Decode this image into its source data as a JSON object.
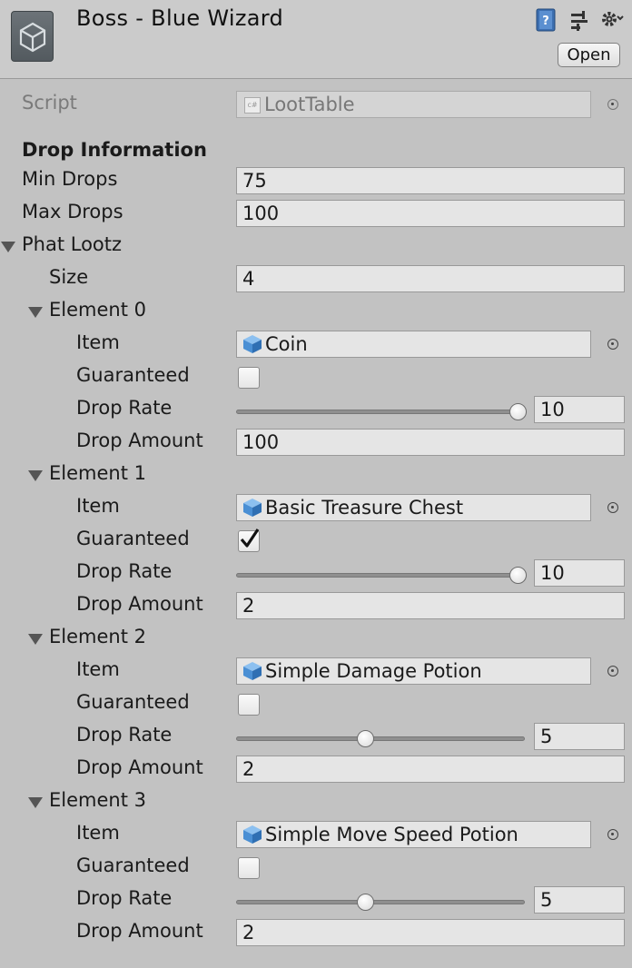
{
  "header": {
    "title": "Boss - Blue Wizard",
    "open_label": "Open",
    "icons": [
      "unity-object-icon",
      "help-book-icon",
      "preset-icon",
      "gear-icon"
    ]
  },
  "script": {
    "label": "Script",
    "value": "LootTable",
    "icon": "csharp-script-icon"
  },
  "drop_info": {
    "heading": "Drop Information",
    "min_label": "Min Drops",
    "min_value": "75",
    "max_label": "Max Drops",
    "max_value": "100"
  },
  "phat_lootz": {
    "label": "Phat Lootz",
    "size_label": "Size",
    "size_value": "4",
    "field_labels": {
      "item": "Item",
      "guaranteed": "Guaranteed",
      "rate": "Drop Rate",
      "amount": "Drop Amount"
    },
    "elements": [
      {
        "label": "Element 0",
        "item": "Coin",
        "guaranteed": false,
        "rate": "10",
        "rate_fraction": 1.0,
        "amount": "100"
      },
      {
        "label": "Element 1",
        "item": "Basic Treasure Chest",
        "guaranteed": true,
        "rate": "10",
        "rate_fraction": 1.0,
        "amount": "2"
      },
      {
        "label": "Element 2",
        "item": "Simple Damage Potion",
        "guaranteed": false,
        "rate": "5",
        "rate_fraction": 0.5,
        "amount": "2"
      },
      {
        "label": "Element 3",
        "item": "Simple Move Speed Potion",
        "guaranteed": false,
        "rate": "5",
        "rate_fraction": 0.5,
        "amount": "2"
      }
    ]
  },
  "colors": {
    "background": "#c2c2c2",
    "field": "#e5e5e5",
    "cube_blue": "#4a8fd4"
  }
}
